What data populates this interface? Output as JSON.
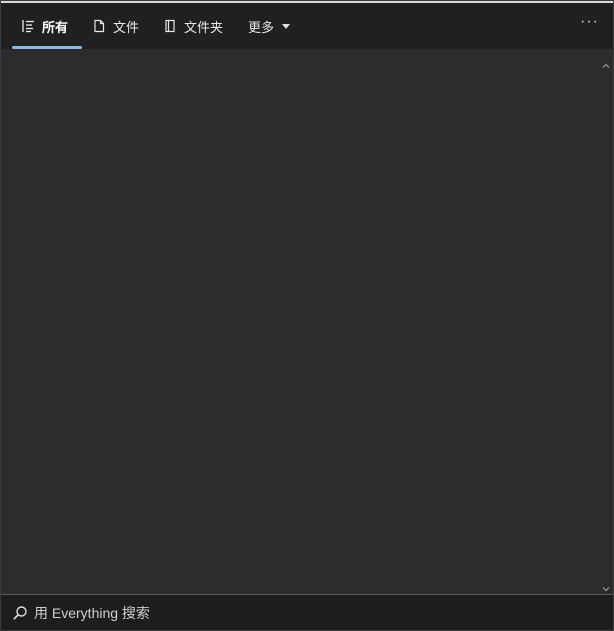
{
  "tabs": [
    {
      "label": "所有",
      "icon": "list-icon",
      "active": true
    },
    {
      "label": "文件",
      "icon": "file-icon",
      "active": false
    },
    {
      "label": "文件夹",
      "icon": "folder-icon",
      "active": false
    },
    {
      "label": "更多",
      "icon": "chevron-down-icon",
      "active": false
    }
  ],
  "toolbar": {
    "more_options": "···"
  },
  "search": {
    "placeholder": "用 Everything 搜索",
    "value": ""
  },
  "colors": {
    "tabbar_bg": "#202020",
    "content_bg": "#2c2c2c",
    "accent": "#8ab8e8",
    "searchbar_bg": "#1d1d1d"
  }
}
